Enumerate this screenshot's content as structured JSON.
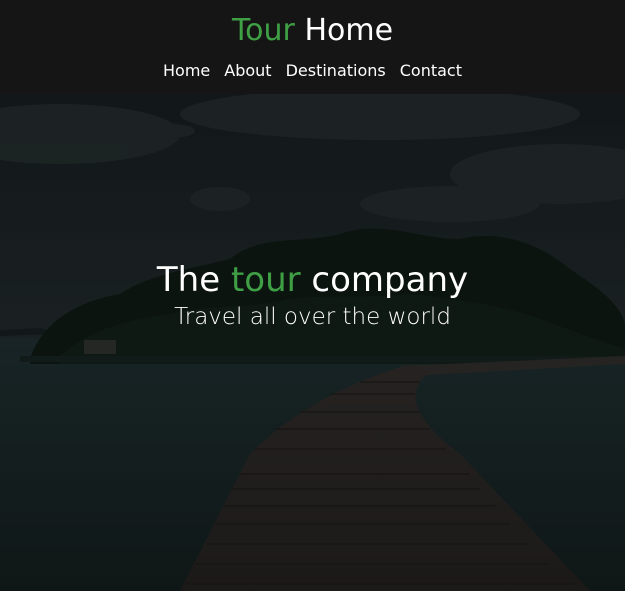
{
  "header": {
    "brand_accent": "Tour",
    "brand_rest": "Home",
    "nav": [
      {
        "label": "Home"
      },
      {
        "label": "About"
      },
      {
        "label": "Destinations"
      },
      {
        "label": "Contact"
      }
    ]
  },
  "hero": {
    "title_start": "The",
    "title_accent": "tour",
    "title_end": "company",
    "subtitle": "Travel all over the world"
  },
  "colors": {
    "accent": "#3f9f45",
    "header_bg": "#151515",
    "text": "#ffffff"
  }
}
